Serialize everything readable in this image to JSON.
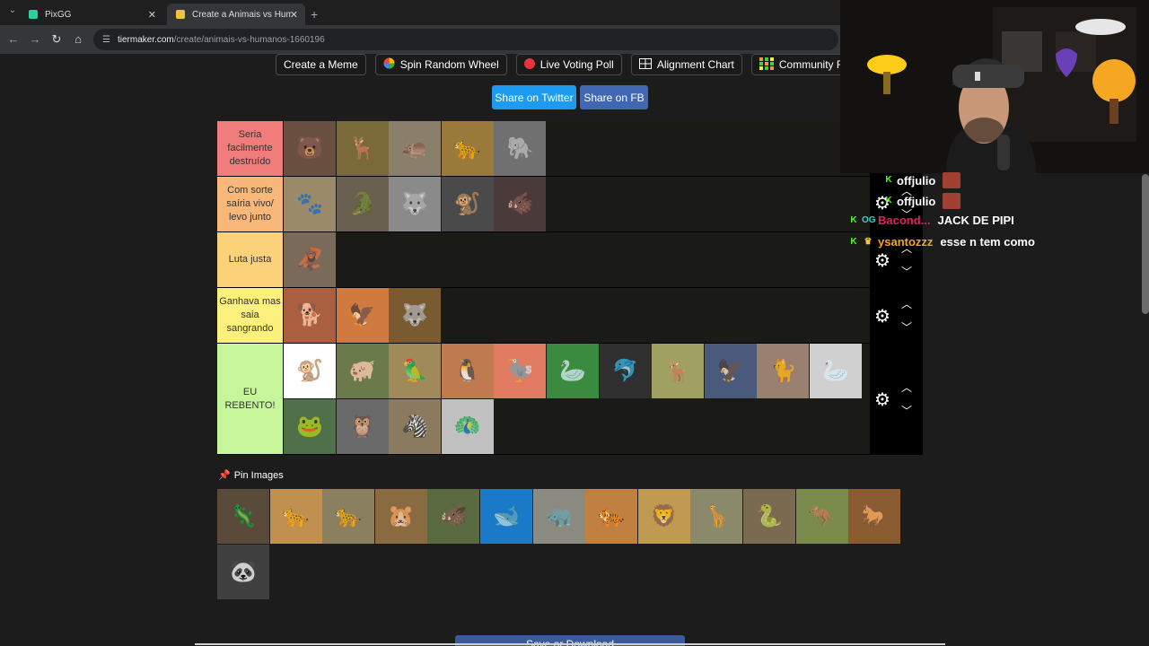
{
  "browser": {
    "tabs": [
      {
        "title": "PixGG",
        "active": false,
        "icon_color": "#2bd1a0"
      },
      {
        "title": "Create a Animais vs Humanos T",
        "active": true,
        "icon_color": "#f0c040"
      }
    ],
    "new_tab_icon": "plus-icon",
    "url_host": "tiermaker.com",
    "url_path": "/create/animais-vs-humanos-1660196"
  },
  "toolbar": {
    "buttons": [
      {
        "label": "Create a Meme",
        "icon": ""
      },
      {
        "label": "Spin Random Wheel",
        "icon": "wheel-icon"
      },
      {
        "label": "Live Voting Poll",
        "icon": "red-dot-icon"
      },
      {
        "label": "Alignment Chart",
        "icon": "grid-icon"
      },
      {
        "label": "Community R",
        "icon": "grid-colored-icon"
      }
    ]
  },
  "share": {
    "twitter_label": "Share on Twitter",
    "fb_label": "Share on FB",
    "twitter_color": "#1d9bf0",
    "fb_color": "#4267b2"
  },
  "tiers": [
    {
      "label": "Seria facilmente destruído",
      "color": "#f07c7c",
      "items": [
        "bear",
        "moose",
        "hippo",
        "jaguar",
        "elephant"
      ]
    },
    {
      "label": "Com sorte saíria vivo/ levo junto",
      "color": "#f7b87a",
      "items": [
        "hyena",
        "crocodile",
        "wolf",
        "chimpanzee",
        "wild boar"
      ]
    },
    {
      "label": "Luta justa",
      "color": "#fbd27a",
      "items": [
        "orangutan"
      ]
    },
    {
      "label": "Ganhava mas saia sangrando",
      "color": "#fdf07d",
      "items": [
        "dog",
        "eagle",
        "maned wolf"
      ]
    },
    {
      "label": "EU REBENTO!",
      "color": "#c7f59a",
      "items": [
        "monkey",
        "pig",
        "macaws",
        "penguin",
        "ostrich",
        "goose",
        "dolphin",
        "deer",
        "hawk",
        "cat",
        "swan",
        "frog",
        "owl",
        "zebra",
        "peacock"
      ]
    }
  ],
  "controls": {
    "gear_icon": "gear-icon",
    "up_icon": "chevron-up-icon",
    "down_icon": "chevron-down-icon"
  },
  "pin": {
    "label": "Pin Images",
    "icon": "pushpin-icon"
  },
  "unranked": [
    "komodo dragon",
    "cheetah",
    "ocelot",
    "capybara",
    "tapir",
    "whale",
    "rhino",
    "tiger",
    "lion",
    "giraffe",
    "cobra",
    "kangaroo",
    "horse",
    "panda"
  ],
  "save_label": "Save or Download",
  "chat": [
    {
      "user": "offjulio",
      "text": "",
      "user_color": "#ffffff",
      "badges": [
        "kick-icon"
      ],
      "emote": "face-emote"
    },
    {
      "user": "offjulio",
      "text": "",
      "user_color": "#ffffff",
      "badges": [
        "kick-icon"
      ],
      "emote": "face-emote"
    },
    {
      "user": "Bacond...",
      "text": "JACK DE PIPI",
      "user_color": "#e0245e",
      "badges": [
        "kick-icon",
        "og-badge"
      ]
    },
    {
      "user": "ysantozzz",
      "text": "esse n tem como",
      "user_color": "#f5a623",
      "badges": [
        "kick-icon",
        "crown-icon"
      ]
    }
  ]
}
